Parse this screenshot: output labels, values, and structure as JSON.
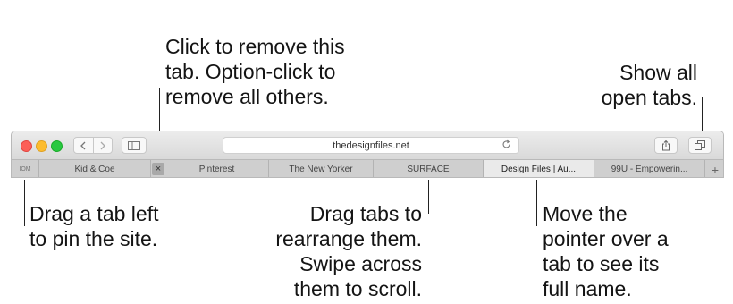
{
  "callouts": {
    "remove_tab": [
      "Click to remove this",
      "tab. Option-click to",
      "remove all others."
    ],
    "show_all": [
      "Show all",
      "open tabs."
    ],
    "pin_site": [
      "Drag a tab left",
      "to pin the site."
    ],
    "rearrange": [
      "Drag tabs to",
      "rearrange them.",
      "Swipe across",
      "them to scroll."
    ],
    "full_name": [
      "Move the",
      "pointer over a",
      "tab to see its",
      "full name."
    ]
  },
  "toolbar": {
    "address": "thedesignfiles.net",
    "icons": {
      "back": "chevron-left-icon",
      "forward": "chevron-right-icon",
      "sidebar": "sidebar-icon",
      "reload": "reload-icon",
      "share": "share-icon",
      "tabs_overview": "tabs-overview-icon"
    }
  },
  "tabs": {
    "pinned_label": "IOM",
    "close_glyph": "×",
    "new_tab_glyph": "+",
    "items": [
      {
        "label": "Kid & Coe"
      },
      {
        "label": "Pinterest"
      },
      {
        "label": "The New Yorker"
      },
      {
        "label": "SURFACE"
      },
      {
        "label": "Design Files | Au...",
        "active": true
      },
      {
        "label": "99U - Empowerin..."
      }
    ]
  },
  "colors": {
    "close": "#fc5f57",
    "minimize": "#fdbc2e",
    "zoom": "#28c840"
  }
}
